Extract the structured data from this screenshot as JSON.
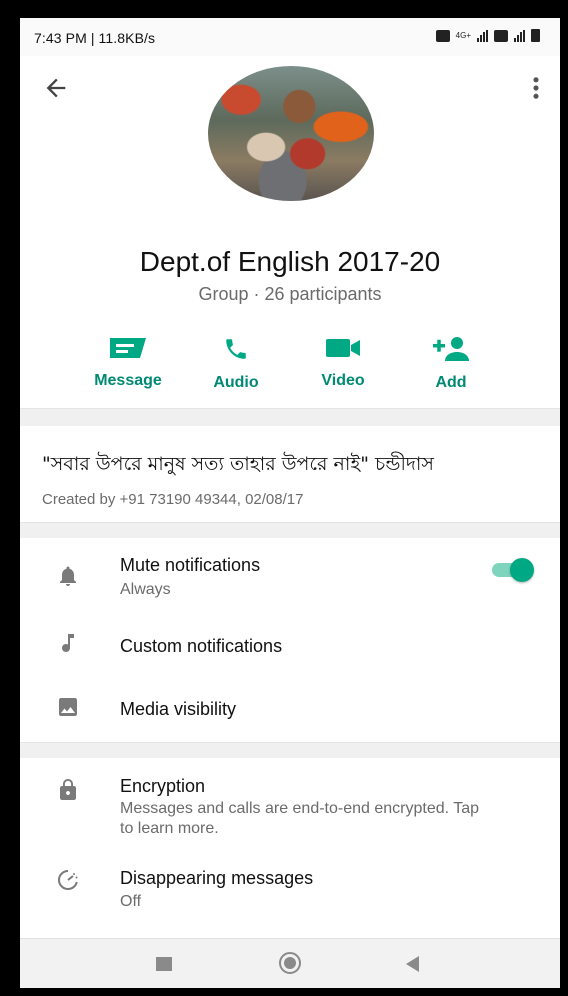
{
  "status_bar": {
    "time": "7:43 PM | 11.8KB/s",
    "network": "4G+"
  },
  "group": {
    "title": "Dept.of English 2017-20",
    "subtitle": "Group · 26 participants"
  },
  "actions": [
    {
      "label": "Message",
      "icon": "message-icon"
    },
    {
      "label": "Audio",
      "icon": "phone-icon"
    },
    {
      "label": "Video",
      "icon": "video-camera-icon"
    },
    {
      "label": "Add",
      "icon": "add-person-icon"
    }
  ],
  "about": {
    "text": "\"সবার উপরে মানুষ সত্য তাহার উপরে নাই\"  চন্ডীদাস",
    "created": "Created by +91 73190 49344, 02/08/17"
  },
  "settings": {
    "mute": {
      "title": "Mute notifications",
      "subtitle": "Always",
      "enabled": true
    },
    "custom": {
      "title": "Custom notifications"
    },
    "media": {
      "title": "Media visibility"
    }
  },
  "privacy": {
    "encryption": {
      "title": "Encryption",
      "subtitle": "Messages and calls are end-to-end encrypted. Tap to learn more."
    },
    "disappearing": {
      "title": "Disappearing messages",
      "subtitle": "Off"
    }
  },
  "colors": {
    "accent": "#00a884",
    "accent_text": "#008a74"
  }
}
